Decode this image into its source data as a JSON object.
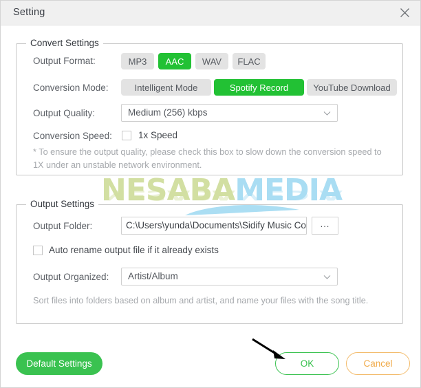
{
  "window": {
    "title": "Setting",
    "close_icon": "close-icon"
  },
  "convert_settings": {
    "legend": "Convert Settings",
    "output_format": {
      "label": "Output Format:",
      "options": [
        "MP3",
        "AAC",
        "WAV",
        "FLAC"
      ],
      "selected": "AAC"
    },
    "conversion_mode": {
      "label": "Conversion Mode:",
      "options": [
        "Intelligent Mode",
        "Spotify Record",
        "YouTube Download"
      ],
      "selected": "Spotify Record"
    },
    "output_quality": {
      "label": "Output Quality:",
      "value": "Medium (256) kbps",
      "chevron_icon": "chevron-down-icon"
    },
    "conversion_speed": {
      "label": "Conversion Speed:",
      "checkbox_label": "1x Speed",
      "checked": false
    },
    "note_line_1": "* To ensure the output quality, please check this box to slow down the conversion speed to",
    "note_line_2": "1X under an unstable network environment."
  },
  "output_settings": {
    "legend": "Output Settings",
    "output_folder": {
      "label": "Output Folder:",
      "value": "C:\\Users\\yunda\\Documents\\Sidify Music Co",
      "browse_label": "..."
    },
    "auto_rename": {
      "checkbox_label": "Auto rename output file if it already exists",
      "checked": false
    },
    "output_organized": {
      "label": "Output Organized:",
      "value": "Artist/Album",
      "chevron_icon": "chevron-down-icon"
    },
    "note": "Sort files into folders based on album and artist, and name your files with the song title."
  },
  "footer": {
    "default_settings_label": "Default Settings",
    "ok_label": "OK",
    "cancel_label": "Cancel"
  },
  "watermark": {
    "part_a": "NESABA",
    "part_b": "MEDIA"
  },
  "colors": {
    "accent_green": "#22c134",
    "button_green": "#3ac250",
    "cancel_orange": "#f0a947",
    "titlebar_bg": "#f0f0f0",
    "watermark_green": "#d2dfa2",
    "watermark_blue": "#a9ddf3"
  }
}
